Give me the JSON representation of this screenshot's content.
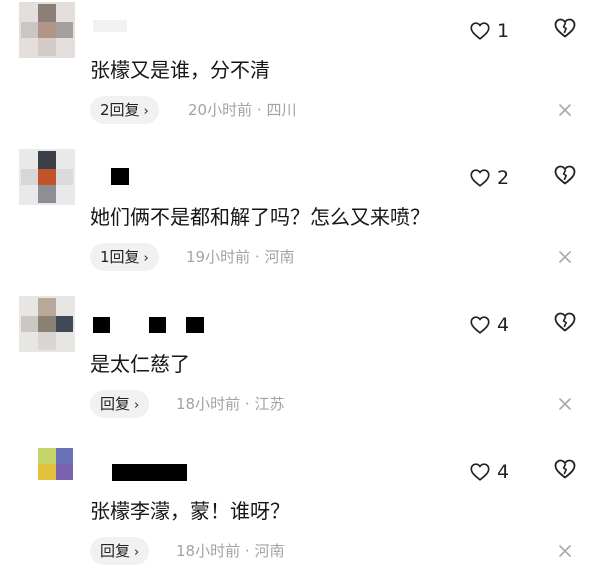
{
  "comments": [
    {
      "text": "张檬又是谁，分不清",
      "reply_label": "2回复",
      "time": "20小时前",
      "location": "四川",
      "likes": "1"
    },
    {
      "text": "她们俩不是都和解了吗？怎么又来喷？",
      "reply_label": "1回复",
      "time": "19小时前",
      "location": "河南",
      "likes": "2"
    },
    {
      "text": "是太仁慈了",
      "reply_label": "回复",
      "time": "18小时前",
      "location": "江苏",
      "likes": "4"
    },
    {
      "text": "张檬李濛，蒙！谁呀？",
      "reply_label": "回复",
      "time": "18小时前",
      "location": "河南",
      "likes": "4"
    }
  ],
  "meta_separator": "·",
  "chevron": "›",
  "icons": {
    "like": "heart-outline-icon",
    "dislike": "broken-heart-icon",
    "close": "close-icon"
  }
}
